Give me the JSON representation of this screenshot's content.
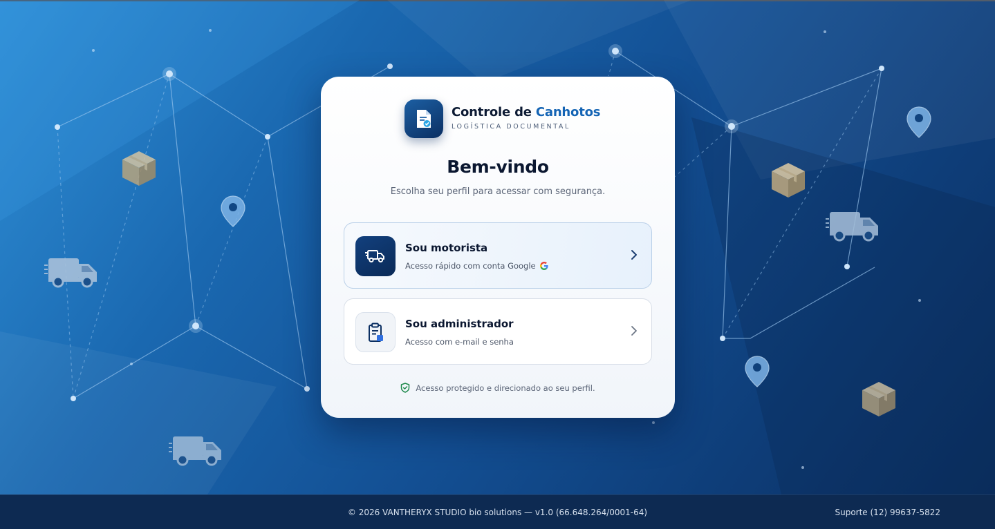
{
  "brand": {
    "title_main": "Controle de",
    "title_accent": "Canhotos",
    "subtitle": "LOGÍSTICA DOCUMENTAL",
    "logo_icon": "document-check-icon"
  },
  "welcome": {
    "title": "Bem-vindo",
    "subtitle": "Escolha seu perfil para acessar com segurança."
  },
  "options": [
    {
      "title": "Sou motorista",
      "description": "Acesso rápido com conta Google",
      "icon": "truck-icon",
      "extra_icon": "google-icon"
    },
    {
      "title": "Sou administrador",
      "description": "Acesso com e-mail e senha",
      "icon": "clipboard-icon"
    }
  ],
  "security_note": "Acesso protegido e direcionado ao seu perfil.",
  "footer": {
    "copyright": "© 2026 VANTHERYX STUDIO bio solutions — v1.0 (66.648.264/0001-64)",
    "support": "Suporte (12) 99637-5822"
  },
  "colors": {
    "accent": "#1464b4",
    "dark_navy": "#0b2f62",
    "background_start": "#2f8fd6",
    "background_end": "#0a2f60",
    "secure_green": "#1f8a4c"
  }
}
